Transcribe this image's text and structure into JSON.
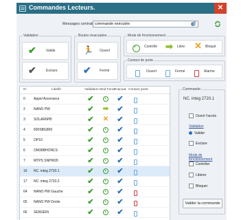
{
  "window": {
    "title": "Commandes Lecteurs."
  },
  "messages": {
    "label": "Messages centrales",
    "value": "commande exécutée"
  },
  "toolbar": {
    "tool1": "tools-icon",
    "tool2": "refresh-icon"
  },
  "validation": {
    "title": "Validation",
    "valide": "Valide",
    "exclure": "Exclure"
  },
  "bouton_evacuation": {
    "title": "Bouton évacuation",
    "ouvert": "Ouvert",
    "ferme": "Fermé"
  },
  "mode": {
    "title": "Mode de fonctionnement",
    "controle": "Contrôlé",
    "libre": "Libre",
    "bloque": "Bloqué"
  },
  "contact": {
    "title": "Contact de porte",
    "ouvert": "Ouvert",
    "ferme": "Fermé",
    "alarme": "Alarme"
  },
  "grid": {
    "headers": [
      "N°",
      "Libellé",
      "Validation",
      "Mod Fonct",
      "Evacuat.",
      "Contact porte"
    ],
    "rows": [
      {
        "no": "0",
        "name": "Appel Ascenseur",
        "mode": "clock",
        "door": "blue"
      },
      {
        "no": "2",
        "name": "NANO PW",
        "mode": "arrow",
        "door": "blue"
      },
      {
        "no": "3",
        "name": "SOLAR6PB",
        "mode": "cross",
        "door": "blue"
      },
      {
        "no": "4",
        "name": "600SBG800",
        "mode": "clock",
        "door": "blue"
      },
      {
        "no": "5",
        "name": "OP10",
        "mode": "clock",
        "door": "blue"
      },
      {
        "no": "6",
        "name": "OM38BHONCS",
        "mode": "clock",
        "door": "blue"
      },
      {
        "no": "7",
        "name": "MTPS SNPW26",
        "mode": "clock",
        "door": "blue"
      },
      {
        "no": "16",
        "name": "NC. integ 2720.1",
        "mode": "clock",
        "door": "blue"
      },
      {
        "no": "17",
        "name": "NC. integ 2720.2",
        "mode": "clock",
        "door": "blue"
      },
      {
        "no": "64",
        "name": "NANO PW Gauche",
        "mode": "clock",
        "door": "red"
      },
      {
        "no": "65",
        "name": "NANO PW Droite",
        "mode": "clock",
        "door": "red"
      },
      {
        "no": "66",
        "name": "SENSEIN",
        "mode": "clock",
        "door": "blue"
      }
    ]
  },
  "commande": {
    "title": "Commande",
    "selected_name": "NC. integ 2720.1",
    "ouvrir": "Ouvrir l'accès",
    "validation_title": "Validation",
    "valider": "Valider",
    "exclure": "Exclure",
    "mode_title": "Mode de fonctionnement",
    "controler": "Contrôler",
    "liberer": "Libérer",
    "bloquer": "Bloquer",
    "button": "Valider la commande"
  }
}
